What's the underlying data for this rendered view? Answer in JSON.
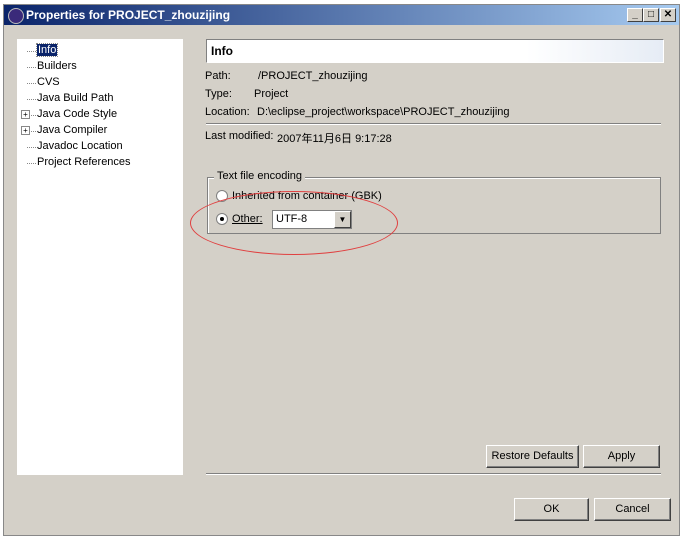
{
  "window": {
    "title": "Properties for PROJECT_zhouzijing"
  },
  "tree": {
    "items": [
      {
        "label": "Info",
        "expandable": false,
        "selected": true
      },
      {
        "label": "Builders",
        "expandable": false
      },
      {
        "label": "CVS",
        "expandable": false
      },
      {
        "label": "Java Build Path",
        "expandable": false
      },
      {
        "label": "Java Code Style",
        "expandable": true
      },
      {
        "label": "Java Compiler",
        "expandable": true
      },
      {
        "label": "Javadoc Location",
        "expandable": false
      },
      {
        "label": "Project References",
        "expandable": false
      }
    ]
  },
  "page": {
    "title": "Info",
    "path_label": "Path:",
    "path": "/PROJECT_zhouzijing",
    "type_label": "Type:",
    "type": "Project",
    "location_label": "Location:",
    "location": "D:\\eclipse_project\\workspace\\PROJECT_zhouzijing",
    "modified_label": "Last modified:",
    "modified": "2007年11月6日 9:17:28"
  },
  "encoding": {
    "group_label": "Text file encoding",
    "inherited_label": "Inherited from container (GBK)",
    "other_label": "Other:",
    "other_value": "UTF-8",
    "selected": "other",
    "annotation_color": "#e04040"
  },
  "buttons": {
    "restore": "Restore Defaults",
    "apply": "Apply",
    "ok": "OK",
    "cancel": "Cancel"
  }
}
